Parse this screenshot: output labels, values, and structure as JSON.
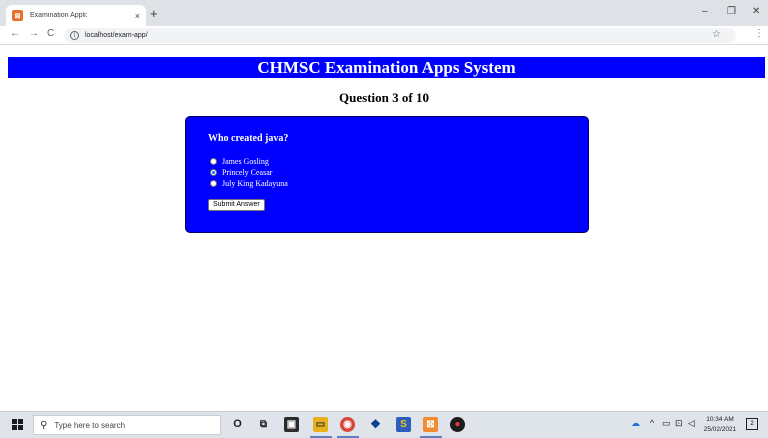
{
  "browser": {
    "tab_title": "Examination Appli:",
    "tab_close": "×",
    "new_tab": "+",
    "url": "localhost/exam-app/",
    "minimize": "–",
    "restore": "❐",
    "close": "✕"
  },
  "page": {
    "banner": "CHMSC Examination Apps System",
    "question_counter": "Question 3 of 10",
    "question": "Who created java?",
    "options": [
      {
        "label": "James Gosling",
        "checked": false
      },
      {
        "label": "Princely Ceasar",
        "checked": true
      },
      {
        "label": "July King Kadayuna",
        "checked": false
      }
    ],
    "submit_label": "Submit Answer"
  },
  "colors": {
    "accent_blue": "#0000ff",
    "banner_text": "#ffffff"
  },
  "taskbar": {
    "search_placeholder": "Type here to search",
    "time": "10:34 AM",
    "date": "25/02/2021",
    "notification_count": "2"
  }
}
